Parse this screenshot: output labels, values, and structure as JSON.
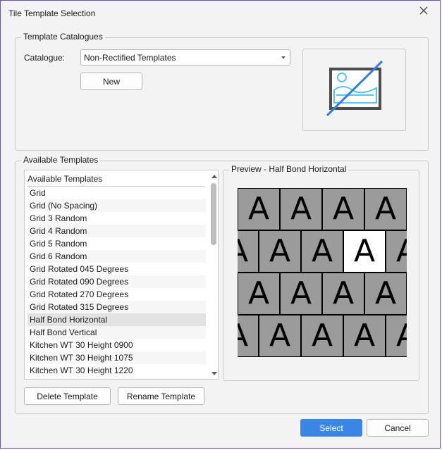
{
  "window": {
    "title": "Tile Template Selection",
    "close_icon": "close-icon"
  },
  "catalogues": {
    "group_label": "Template Catalogues",
    "catalogue_label": "Catalogue:",
    "catalogue_value": "Non-Rectified Templates",
    "new_button": "New",
    "thumbnail_icon": "no-image-icon"
  },
  "available": {
    "group_label": "Available Templates",
    "list_header": "Available Templates",
    "items": [
      "Grid",
      "Grid (No Spacing)",
      "Grid 3 Random",
      "Grid 4 Random",
      "Grid 5 Random",
      "Grid 6 Random",
      "Grid Rotated 045 Degrees",
      "Grid Rotated 090 Degrees",
      "Grid Rotated 270 Degrees",
      "Grid Rotated 315 Degrees",
      "Half Bond Horizontal",
      "Half Bond Vertical",
      "Kitchen WT 30 Height 0900",
      "Kitchen WT 30 Height 1075",
      "Kitchen WT 30 Height 1220"
    ],
    "selected_index": 10,
    "delete_button": "Delete Template",
    "rename_button": "Rename Template"
  },
  "preview": {
    "label": "Preview - Half Bond Horizontal",
    "tile_glyph": "A",
    "colors": {
      "tile": "#9b9b9b",
      "highlight": "#ffffff",
      "grout": "#000000"
    }
  },
  "footer": {
    "select_button": "Select",
    "cancel_button": "Cancel"
  }
}
